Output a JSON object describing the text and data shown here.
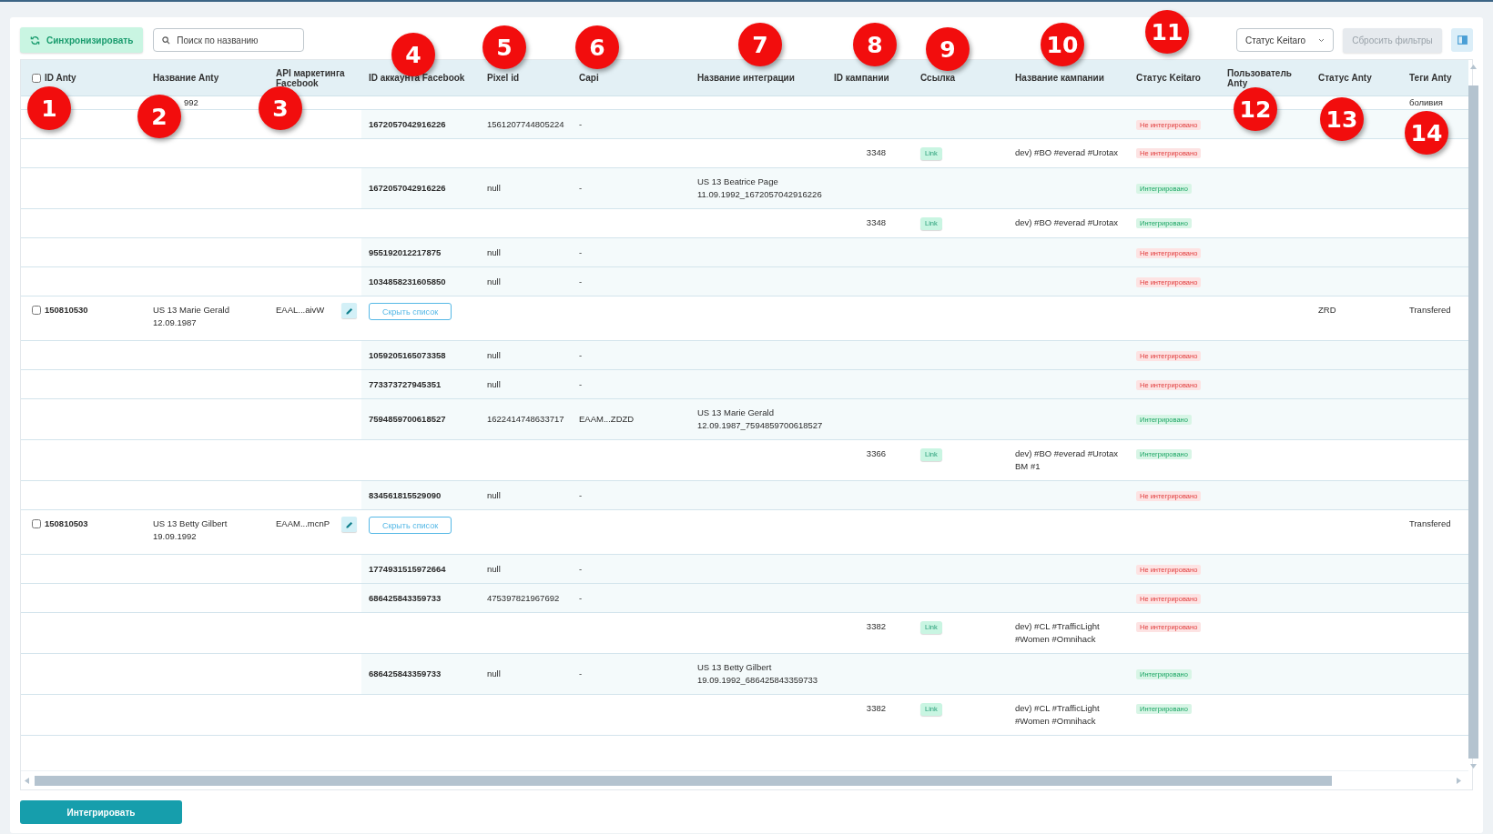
{
  "toolbar": {
    "sync_button": "Синхронизировать",
    "search": {
      "placeholder": "Поиск по названию"
    },
    "status_filter": "Статус Keitaro",
    "reset_button": "Сбросить фильтры"
  },
  "table": {
    "header_checkbox": {
      "checked": false
    },
    "columns": [
      "ID Anty",
      "Название Anty",
      "API маркетинга Facebook",
      "ID аккаунта Facebook",
      "Pixel id",
      "Capi",
      "Название интеграции",
      "ID кампании",
      "Ссылка",
      "Название кампании",
      "Статус Keitaro",
      "Пользователь Anty",
      "Статус Anty",
      "Теги Anty"
    ],
    "rows": [
      {
        "kind": "partial",
        "name": "992",
        "tags": "боливия"
      },
      {
        "kind": "account",
        "fb_id": "1672057042916226",
        "pixel": "1561207744805224",
        "capi": "-",
        "keitaro": {
          "label": "Не интегрировано",
          "integrated": false
        }
      },
      {
        "kind": "campaign",
        "campaign_id": "3348",
        "link": "Link",
        "campaign_name": "dev) #BO #everad #Urotax",
        "keitaro": {
          "label": "Не интегрировано",
          "integrated": false
        }
      },
      {
        "kind": "account",
        "fb_id": "1672057042916226",
        "pixel": "null",
        "capi": "-",
        "integration": "US 13 Beatrice Page 11.09.1992_1672057042916226",
        "keitaro": {
          "label": "Интегрировано",
          "integrated": true
        }
      },
      {
        "kind": "campaign",
        "campaign_id": "3348",
        "link": "Link",
        "campaign_name": "dev) #BO #everad #Urotax",
        "keitaro": {
          "label": "Интегрировано",
          "integrated": true
        }
      },
      {
        "kind": "account",
        "fb_id": "955192012217875",
        "pixel": "null",
        "capi": "-",
        "keitaro": {
          "label": "Не интегрировано",
          "integrated": false
        }
      },
      {
        "kind": "account",
        "fb_id": "1034858231605850",
        "pixel": "null",
        "capi": "-",
        "keitaro": {
          "label": "Не интегрировано",
          "integrated": false
        }
      },
      {
        "kind": "parent",
        "checked": false,
        "id": "150810530",
        "name": "US 13 Marie Gerald 12.09.1987",
        "api": "EAAL...aivW",
        "toggle": "Скрыть список",
        "status_anty": "ZRD",
        "tags": "Transfered"
      },
      {
        "kind": "account",
        "fb_id": "1059205165073358",
        "pixel": "null",
        "capi": "-",
        "keitaro": {
          "label": "Не интегрировано",
          "integrated": false
        }
      },
      {
        "kind": "account",
        "fb_id": "773373727945351",
        "pixel": "null",
        "capi": "-",
        "keitaro": {
          "label": "Не интегрировано",
          "integrated": false
        }
      },
      {
        "kind": "account",
        "fb_id": "7594859700618527",
        "pixel": "1622414748633717",
        "capi": "EAAM...ZDZD",
        "integration": "US 13 Marie Gerald 12.09.1987_7594859700618527",
        "keitaro": {
          "label": "Интегрировано",
          "integrated": true
        }
      },
      {
        "kind": "campaign",
        "campaign_id": "3366",
        "link": "Link",
        "campaign_name": "dev) #BO #everad #Urotax BM #1",
        "keitaro": {
          "label": "Интегрировано",
          "integrated": true
        }
      },
      {
        "kind": "account",
        "fb_id": "834561815529090",
        "pixel": "null",
        "capi": "-",
        "keitaro": {
          "label": "Не интегрировано",
          "integrated": false
        }
      },
      {
        "kind": "parent",
        "checked": false,
        "id": "150810503",
        "name": "US 13 Betty Gilbert 19.09.1992",
        "api": "EAAM...mcnP",
        "toggle": "Скрыть список",
        "tags": "Transfered"
      },
      {
        "kind": "account",
        "fb_id": "1774931515972664",
        "pixel": "null",
        "capi": "-",
        "keitaro": {
          "label": "Не интегрировано",
          "integrated": false
        }
      },
      {
        "kind": "account",
        "fb_id": "686425843359733",
        "pixel": "475397821967692",
        "capi": "-",
        "keitaro": {
          "label": "Не интегрировано",
          "integrated": false
        }
      },
      {
        "kind": "campaign",
        "campaign_id": "3382",
        "link": "Link",
        "campaign_name": "dev) #CL #TrafficLight #Women #Omnihack",
        "keitaro": {
          "label": "Не интегрировано",
          "integrated": false
        }
      },
      {
        "kind": "account",
        "fb_id": "686425843359733",
        "pixel": "null",
        "capi": "-",
        "integration": "US 13 Betty Gilbert 19.09.1992_686425843359733",
        "keitaro": {
          "label": "Интегрировано",
          "integrated": true
        }
      },
      {
        "kind": "campaign",
        "campaign_id": "3382",
        "link": "Link",
        "campaign_name": "dev) #CL #TrafficLight #Women #Omnihack",
        "keitaro": {
          "label": "Интегрировано",
          "integrated": true
        }
      }
    ]
  },
  "integrate_button": "Интегрировать",
  "annotations": [
    "1",
    "2",
    "3",
    "4",
    "5",
    "6",
    "7",
    "8",
    "9",
    "10",
    "11",
    "12",
    "13",
    "14"
  ]
}
